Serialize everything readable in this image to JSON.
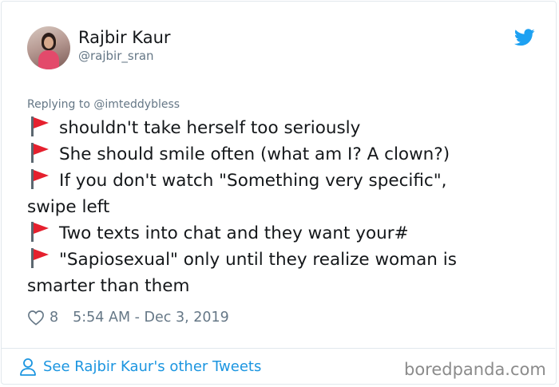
{
  "tweet": {
    "author_name": "Rajbir Kaur",
    "author_handle": "@rajbir_sran",
    "replying_to": "Replying to @imteddybless",
    "lines": [
      "shouldn't take herself too seriously",
      "She should smile often (what am I? A clown?)",
      "If you don't watch \"Something very specific\",",
      "swipe left",
      "Two texts into chat and they want your#",
      "\"Sapiosexual\" only until they realize woman is",
      "smarter than them"
    ],
    "like_count": "8",
    "timestamp": "5:54 AM - Dec 3, 2019"
  },
  "footer": {
    "see_more_label": "See Rajbir Kaur's other Tweets",
    "watermark": "boredpanda.com"
  },
  "colors": {
    "link_blue": "#1b95e0",
    "twitter_blue": "#1da1f2",
    "secondary_text": "#657786",
    "flag_red": "#e5202e"
  },
  "icons": [
    "avatar",
    "twitter-bird-icon",
    "red-flag-icon",
    "heart-icon",
    "person-icon"
  ]
}
